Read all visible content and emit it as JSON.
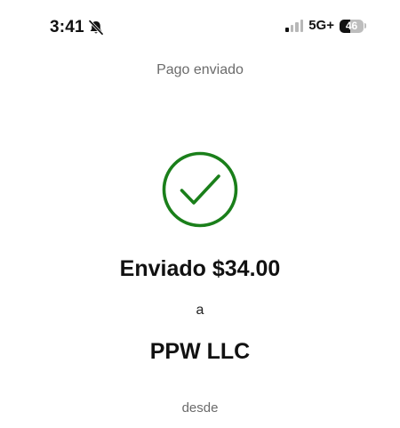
{
  "status_bar": {
    "time": "3:41",
    "silent_icon": "bell-slash-icon",
    "signal_bars_active": 1,
    "signal_bars_total": 4,
    "network": "5G+",
    "battery_level": "46",
    "battery_fraction": 0.46
  },
  "header": {
    "title": "Pago enviado"
  },
  "confirmation": {
    "icon": "checkmark-circle-icon",
    "sent_label": "Enviado",
    "amount": "$34.00",
    "to_label": "a",
    "recipient": "PPW LLC",
    "from_label": "desde"
  },
  "colors": {
    "success": "#1a7f1a",
    "text_primary": "#111111",
    "text_secondary": "#6b6b6b",
    "signal_inactive": "#b8b8b8",
    "background": "#ffffff"
  }
}
